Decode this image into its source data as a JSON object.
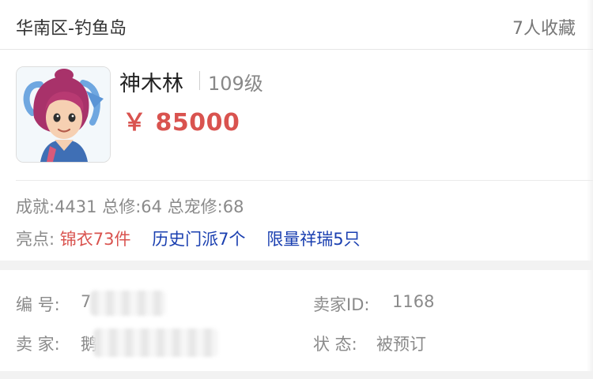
{
  "header": {
    "server": "华南区-钓鱼岛",
    "favorites": "7人收藏"
  },
  "item": {
    "avatar_icon": "character-portrait-icon",
    "name": "神木林",
    "level": "109级",
    "price": "￥ 85000"
  },
  "stats": {
    "line": "成就:4431 总修:64 总宠修:68"
  },
  "highlights": {
    "label": "亮点:",
    "tags": [
      "锦衣73件",
      "历史门派7个",
      "限量祥瑞5只"
    ]
  },
  "details": {
    "number_label": "编 号:",
    "number_value": "7",
    "seller_id_label": "卖家ID:",
    "seller_id_value": "1168",
    "seller_label": "卖 家:",
    "seller_value": "鹅",
    "status_label": "状 态:",
    "status_value": "被预订"
  },
  "colors": {
    "price": "#d9534f",
    "highlight_red": "#d9534f",
    "highlight_blue": "#1a3fb0",
    "muted": "#8a8a8a"
  }
}
